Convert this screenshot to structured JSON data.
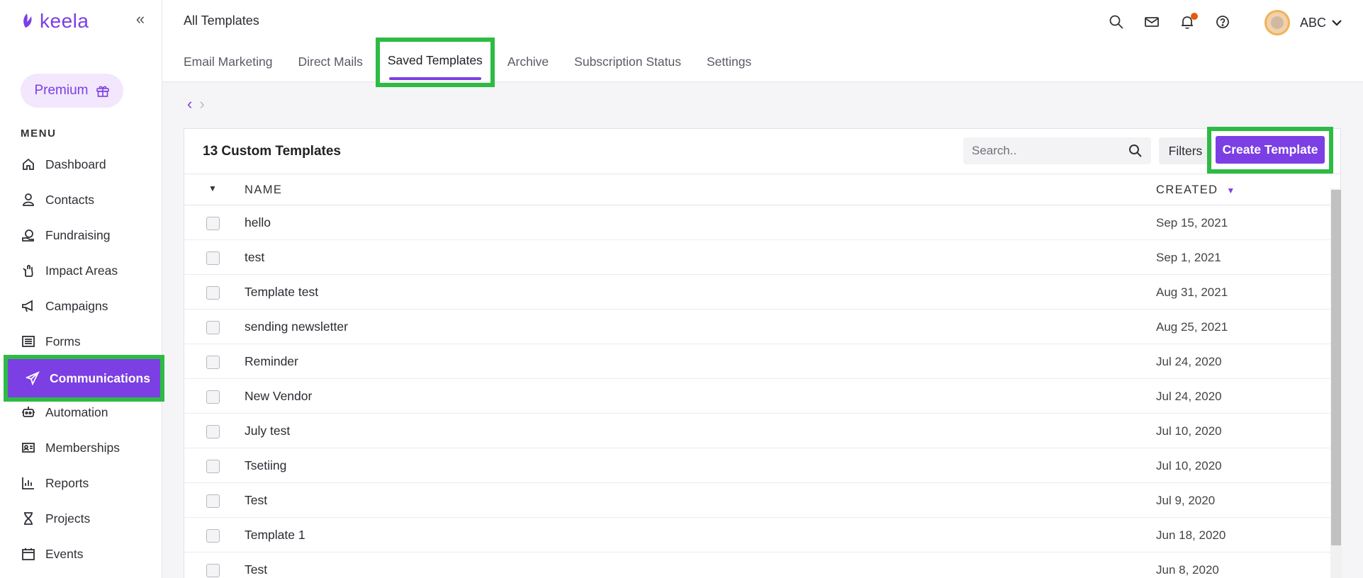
{
  "app": {
    "logo_text": "keela",
    "collapse_icon": "double-chevron-left-icon"
  },
  "sidebar": {
    "premium_label": "Premium",
    "menu_title": "MENU",
    "items": [
      {
        "label": "Dashboard",
        "icon": "home-icon"
      },
      {
        "label": "Contacts",
        "icon": "user-icon"
      },
      {
        "label": "Fundraising",
        "icon": "fundraising-icon"
      },
      {
        "label": "Impact Areas",
        "icon": "hand-icon"
      },
      {
        "label": "Campaigns",
        "icon": "megaphone-icon"
      },
      {
        "label": "Forms",
        "icon": "forms-icon"
      },
      {
        "label": "Communications",
        "icon": "send-icon",
        "active": true
      },
      {
        "label": "Automation",
        "icon": "robot-icon"
      },
      {
        "label": "Memberships",
        "icon": "id-card-icon"
      },
      {
        "label": "Reports",
        "icon": "bar-chart-icon"
      },
      {
        "label": "Projects",
        "icon": "hourglass-icon"
      },
      {
        "label": "Events",
        "icon": "calendar-icon"
      }
    ]
  },
  "header": {
    "title": "All Templates",
    "user_name": "ABC",
    "tabs": [
      {
        "label": "Email Marketing"
      },
      {
        "label": "Direct Mails"
      },
      {
        "label": "Saved Templates",
        "active": true
      },
      {
        "label": "Archive"
      },
      {
        "label": "Subscription Status"
      },
      {
        "label": "Settings"
      }
    ]
  },
  "pager": {
    "prev": "‹",
    "next": "›"
  },
  "card": {
    "title": "13 Custom Templates",
    "search_placeholder": "Search..",
    "filters_label": "Filters",
    "create_label": "Create Template",
    "columns": {
      "name": "NAME",
      "created": "CREATED"
    },
    "rows": [
      {
        "name": "hello",
        "created": "Sep 15, 2021"
      },
      {
        "name": "test",
        "created": "Sep 1, 2021"
      },
      {
        "name": "Template test",
        "created": "Aug 31, 2021"
      },
      {
        "name": "sending newsletter",
        "created": "Aug 25, 2021"
      },
      {
        "name": "Reminder",
        "created": "Jul 24, 2020"
      },
      {
        "name": "New Vendor",
        "created": "Jul 24, 2020"
      },
      {
        "name": "July test",
        "created": "Jul 10, 2020"
      },
      {
        "name": "Tsetiing",
        "created": "Jul 10, 2020"
      },
      {
        "name": "Test",
        "created": "Jul 9, 2020"
      },
      {
        "name": "Template 1",
        "created": "Jun 18, 2020"
      },
      {
        "name": "Test",
        "created": "Jun 8, 2020"
      }
    ]
  },
  "colors": {
    "accent": "#7b3fe4",
    "highlight": "#2ebb44",
    "notification": "#e8590c"
  }
}
